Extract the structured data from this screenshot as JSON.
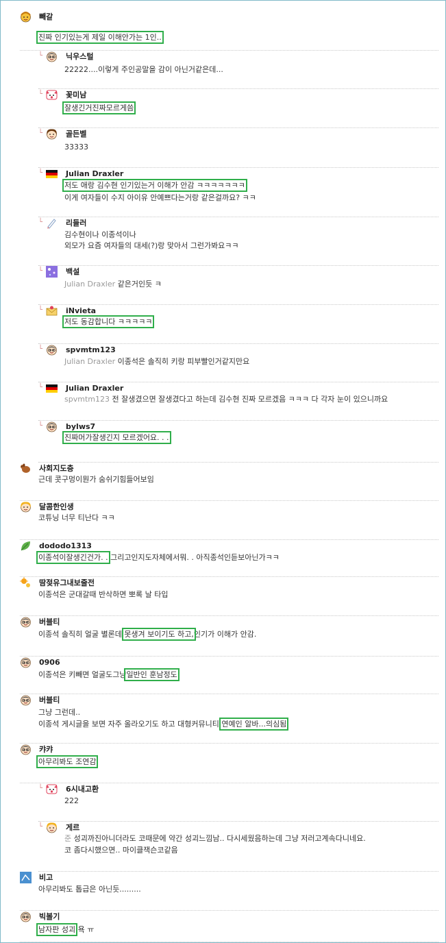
{
  "highlight_color": "#2fae4a",
  "comments": [
    {
      "id": "c0",
      "nick": "빼갈",
      "icon": "yellow-face-icon",
      "lines": [
        [
          {
            "t": "진짜 인기있는게 제일 이해안가는 1인..",
            "hl": true
          }
        ]
      ]
    },
    {
      "id": "c1",
      "nick": "닉우스털",
      "icon": "glasses-face-icon",
      "lines": [
        [
          {
            "t": "22222....이렇게 주인공말을 감이 아닌거같은데..."
          }
        ]
      ]
    },
    {
      "id": "c2",
      "nick": "꽃미남",
      "icon": "pink-face-icon",
      "lines": [
        [
          {
            "t": "잘생긴거진짜모르게씀",
            "hl": true
          }
        ]
      ]
    },
    {
      "id": "c3",
      "nick": "골든벨",
      "icon": "brown-hair-face-icon",
      "lines": [
        [
          {
            "t": "33333"
          }
        ]
      ]
    },
    {
      "id": "c4",
      "nick": "Julian Draxler",
      "icon": "german-flag-icon",
      "lines": [
        [
          {
            "t": "저도 애랑 김수현 인기있는거 이해가 안감 ㅋㅋㅋㅋㅋㅋㅋ",
            "hl": true
          }
        ],
        [
          {
            "t": "이게 여자들이 수지 아이유 안예쁘다는거랑 같은걸까요? ㅋㅋ"
          }
        ]
      ]
    },
    {
      "id": "c5",
      "nick": "리들러",
      "icon": "pen-icon",
      "lines": [
        [
          {
            "t": "김수현이나 이종석이나"
          }
        ],
        [
          {
            "t": "외모가 요즘 여자들의 대세(?)랑 맞아서 그런가봐요ㅋㅋ"
          }
        ]
      ]
    },
    {
      "id": "c6",
      "nick": "백설",
      "icon": "sparkle-icon",
      "lines": [
        [
          {
            "t": "Julian Draxler ",
            "ref": true
          },
          {
            "t": "같은거인듯 ㅋ"
          }
        ]
      ]
    },
    {
      "id": "c7",
      "nick": "iNvieta",
      "icon": "envelope-icon",
      "lines": [
        [
          {
            "t": "저도 동감합니다 ㅋㅋㅋㅋㅋ",
            "hl": true
          }
        ]
      ]
    },
    {
      "id": "c8",
      "nick": "spvmtm123",
      "icon": "glasses-face-icon",
      "lines": [
        [
          {
            "t": "Julian Draxler ",
            "ref": true
          },
          {
            "t": "이종석은 솔직히 키랑 피부빨인거같지만요"
          }
        ]
      ]
    },
    {
      "id": "c9",
      "nick": "Julian Draxler",
      "icon": "german-flag-icon",
      "lines": [
        [
          {
            "t": "spvmtm123 ",
            "ref": true
          },
          {
            "t": "전 잘생겼으면 잘생겼다고 하는데 김수현 진짜 모르겠음 ㅋㅋㅋ 다 각자 눈이 있으니까요"
          }
        ]
      ]
    },
    {
      "id": "c10",
      "nick": "bylws7",
      "icon": "glasses-face-icon",
      "lines": [
        [
          {
            "t": "진짜머가잘생긴지 모르겠어요. . .",
            "hl": true
          }
        ]
      ]
    },
    {
      "id": "c11",
      "nick": "사회지도층",
      "icon": "dog-icon",
      "lines": [
        [
          {
            "t": "근데 콧구멍이뭔가 숨쉬기힘들어보임"
          }
        ]
      ]
    },
    {
      "id": "c12",
      "nick": "달콤한인생",
      "icon": "blonde-face-icon",
      "lines": [
        [
          {
            "t": "코튜닝 너무 티난다 ㅋㅋ"
          }
        ]
      ]
    },
    {
      "id": "c13",
      "nick": "dododo1313",
      "icon": "leaf-icon",
      "lines": [
        [
          {
            "t": "이종석이잘생긴건가. .",
            "hl": true
          },
          {
            "t": " 그리고인지도자체에서뭐. . 아직종석인듣보아닌가ㅋㅋ"
          }
        ]
      ]
    },
    {
      "id": "c14",
      "nick": "땀젖유그내보줄전",
      "icon": "sun-icon",
      "lines": [
        [
          {
            "t": "이종석은 군대갈때 반삭하면 뽀록 날 타입"
          }
        ]
      ]
    },
    {
      "id": "c15",
      "nick": "버블티",
      "icon": "glasses-face-icon",
      "lines": [
        [
          {
            "t": "이종석 솔직히 얼굴 별론데."
          },
          {
            "t": "못생겨 보이기도 하고,",
            "hl": true
          },
          {
            "t": "인기가 이해가 안감."
          }
        ]
      ]
    },
    {
      "id": "c16",
      "nick": "0906",
      "icon": "glasses-face-icon",
      "lines": [
        [
          {
            "t": "이종석은 키빼면 얼굴도그냥"
          },
          {
            "t": "일반인 훈남정도",
            "hl": true
          }
        ]
      ]
    },
    {
      "id": "c17",
      "nick": "버블티",
      "icon": "glasses-face-icon",
      "lines": [
        [
          {
            "t": "그냥 그런데.."
          }
        ],
        [
          {
            "t": "이종석 게시글을 보면 자주 올라오기도 하고 대형커뮤니티 "
          },
          {
            "t": "연예인 알바...의심됨",
            "hl": true
          }
        ]
      ]
    },
    {
      "id": "c18",
      "nick": "캬캬",
      "icon": "glasses-face-icon",
      "lines": [
        [
          {
            "t": "아무리봐도 조연감",
            "hl": true
          }
        ]
      ]
    },
    {
      "id": "c19",
      "nick": "6시내고환",
      "icon": "pink-face-icon",
      "lines": [
        [
          {
            "t": "222"
          }
        ]
      ]
    },
    {
      "id": "c20",
      "nick": "게르",
      "icon": "blonde-face-icon",
      "lines": [
        [
          {
            "t": "준 ",
            "ref": true
          },
          {
            "t": "성괴까진아니더라도 코때문에 약간 성괴느낌남.. 다시세웠음하는데 그냥 저러고계속다니네요."
          }
        ],
        [
          {
            "t": "코 좀다시했으면.. 마이클잭슨코같음"
          }
        ]
      ]
    },
    {
      "id": "c21",
      "nick": "비고",
      "icon": "blue-square-icon",
      "lines": [
        [
          {
            "t": "아무리봐도 톱급은 아닌듯........."
          }
        ]
      ]
    },
    {
      "id": "c22",
      "nick": "빅볼기",
      "icon": "glasses-face-icon",
      "lines": [
        [
          {
            "t": "남자판 성괴",
            "hl": true
          },
          {
            "t": " 욕 ㅠ"
          }
        ]
      ]
    }
  ]
}
